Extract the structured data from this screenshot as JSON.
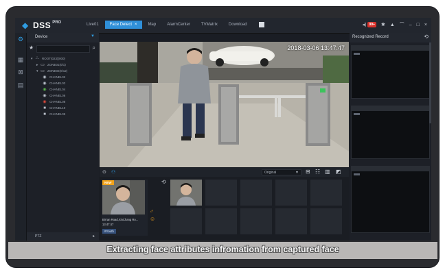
{
  "app": {
    "name": "DSS",
    "edition": "PRO"
  },
  "tabs": [
    {
      "label": "Live01",
      "active": false
    },
    {
      "label": "Face Detect",
      "active": true,
      "close": "×"
    },
    {
      "label": "Map",
      "active": false
    },
    {
      "label": "AlarmCenter",
      "active": false
    },
    {
      "label": "TVMatrix",
      "active": false
    },
    {
      "label": "Download",
      "active": false
    }
  ],
  "tray": {
    "alarm_count": "99+"
  },
  "device_panel": {
    "title": "Device",
    "tree": [
      {
        "label": "ROOT(023)(000)",
        "icon": "org-icon",
        "depth": 0
      },
      {
        "label": "ZONE01(0/1)",
        "icon": "folder-icon",
        "depth": 1
      },
      {
        "label": "ZONE02(0/12)",
        "icon": "folder-icon",
        "depth": 1
      },
      {
        "label": "CHANEL02",
        "icon": "camera-icon",
        "depth": 2
      },
      {
        "label": "CHANEL03",
        "icon": "camera-icon",
        "depth": 2
      },
      {
        "label": "CHANEL04",
        "icon": "camera-icon",
        "depth": 2
      },
      {
        "label": "CHANEL06",
        "icon": "camera-icon",
        "depth": 2
      },
      {
        "label": "CHANEL08",
        "icon": "camera-icon",
        "depth": 2
      },
      {
        "label": "CHANEL10",
        "icon": "camera-icon",
        "depth": 2
      },
      {
        "label": "CHANEL05",
        "icon": "camera-icon",
        "depth": 2
      }
    ],
    "ptz_label": "PTZ"
  },
  "video": {
    "timestamp": "2018-03-06 13:47:47"
  },
  "stream": {
    "selected": "Original"
  },
  "capture_card": {
    "new_badge": "NEW",
    "title": "Bin'an Road,XinChang Ro...",
    "time": "13:47:47",
    "tag": "#Youth"
  },
  "records": {
    "title": "Recognized Record"
  },
  "caption": "Extracting face attributes infromation from captured face",
  "colors": {
    "accent": "#2f8fd8",
    "badge": "#d9312b",
    "new": "#f1a21b"
  }
}
